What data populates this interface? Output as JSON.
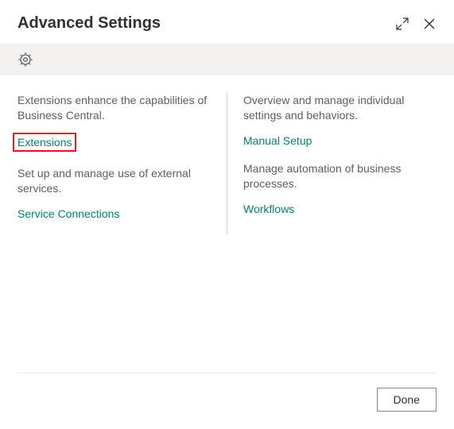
{
  "header": {
    "title": "Advanced Settings"
  },
  "left": {
    "desc1": "Extensions enhance the capabilities of Business Central.",
    "link1": "Extensions",
    "desc2": "Set up and manage use of external services.",
    "link2": "Service Connections"
  },
  "right": {
    "desc1": "Overview and manage individual settings and behaviors.",
    "link1": "Manual Setup",
    "desc2": "Manage automation of business processes.",
    "link2": "Workflows"
  },
  "footer": {
    "done": "Done"
  }
}
